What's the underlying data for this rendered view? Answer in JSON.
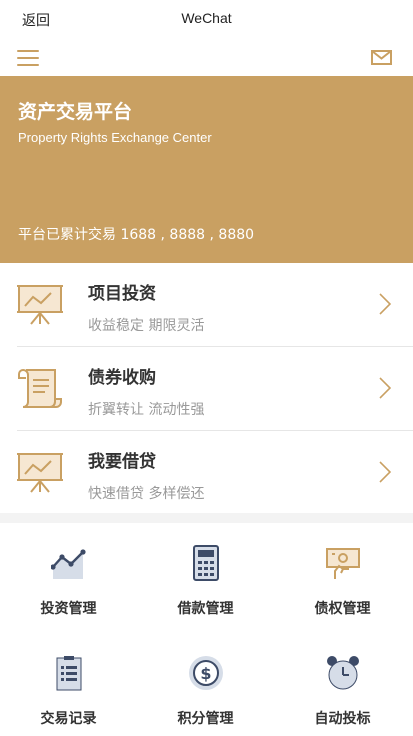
{
  "statusbar": {
    "back_label": "返回",
    "title": "WeChat"
  },
  "toolbar": {
    "menu_icon": "hamburger-icon",
    "mail_icon": "mail-icon"
  },
  "colors": {
    "brand": "#c9a062",
    "icon_slate": "#3d4b67",
    "icon_fill": "#d6dde8"
  },
  "hero": {
    "title": "资产交易平台",
    "subtitle": "Property Rights Exchange Center",
    "total_text": "平台已累计交易 1688 , 8888 , 8880"
  },
  "products": [
    {
      "name": "项目投资",
      "desc": "收益稳定 期限灵活",
      "icon": "chart-board-icon"
    },
    {
      "name": "债券收购",
      "desc": "折翼转让 流动性强",
      "icon": "scroll-icon"
    },
    {
      "name": "我要借贷",
      "desc": "快速借贷 多样偿还",
      "icon": "chart-board-icon"
    }
  ],
  "grid": [
    {
      "label": "投资管理",
      "icon": "line-chart-icon"
    },
    {
      "label": "借款管理",
      "icon": "calculator-icon"
    },
    {
      "label": "债权管理",
      "icon": "cash-hand-icon"
    },
    {
      "label": "交易记录",
      "icon": "clipboard-list-icon"
    },
    {
      "label": "积分管理",
      "icon": "dollar-coin-icon"
    },
    {
      "label": "自动投标",
      "icon": "alarm-clock-icon"
    }
  ]
}
